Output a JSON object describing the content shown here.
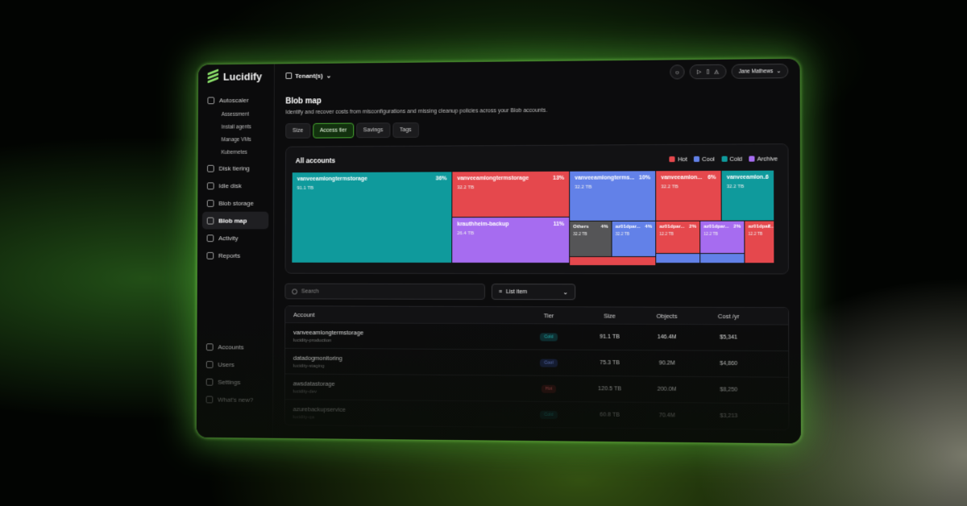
{
  "brand": {
    "name": "Lucidify",
    "accent": "#8be06a"
  },
  "sidebar": {
    "items": [
      {
        "label": "Autoscaler",
        "icon": "autoscaler-icon"
      },
      {
        "label": "Assessment",
        "sub": true
      },
      {
        "label": "Install agents",
        "sub": true
      },
      {
        "label": "Manage VMs",
        "sub": true
      },
      {
        "label": "Kubernetes",
        "sub": true
      },
      {
        "label": "Disk tiering",
        "icon": "disk-icon"
      },
      {
        "label": "Idle disk",
        "icon": "idle-disk-icon"
      },
      {
        "label": "Blob storage",
        "icon": "blob-icon"
      },
      {
        "label": "Blob map",
        "icon": "map-icon",
        "active": true
      },
      {
        "label": "Activity",
        "icon": "activity-icon"
      },
      {
        "label": "Reports",
        "icon": "reports-icon"
      }
    ],
    "bottom": [
      {
        "label": "Accounts",
        "icon": "key-icon"
      },
      {
        "label": "Users",
        "icon": "user-icon"
      },
      {
        "label": "Settings",
        "icon": "gear-icon"
      },
      {
        "label": "What's new?",
        "icon": "sparkle-icon"
      }
    ]
  },
  "topbar": {
    "tenant": "Tenant(s)",
    "user": "Jane Mathews"
  },
  "page": {
    "title": "Blob map",
    "subtitle": "Identify and recover costs from misconfigurations and missing cleanup policies across your Blob accounts."
  },
  "tabs": [
    "Size",
    "Access tier",
    "Savings",
    "Tags"
  ],
  "active_tab": "Access tier",
  "card": {
    "title": "All accounts",
    "legend": [
      {
        "label": "Hot",
        "color": "#e5484d"
      },
      {
        "label": "Cool",
        "color": "#6281e8"
      },
      {
        "label": "Cold",
        "color": "#0f9a9c"
      },
      {
        "label": "Archive",
        "color": "#a66cf0"
      }
    ],
    "tiles": [
      {
        "name": "vanveeamlongtermstorage",
        "pct": "36%",
        "size": "91.1 TB"
      },
      {
        "name": "vanveeamlongtermstorage",
        "pct": "13%",
        "size": "32.2 TB"
      },
      {
        "name": "krauthheim-backup",
        "pct": "11%",
        "size": "26.4 TB"
      },
      {
        "name": "vanveeamlongterms...",
        "pct": "10%",
        "size": "32.2 TB"
      },
      {
        "name": "Others",
        "pct": "4%",
        "size": "32.2 TB"
      },
      {
        "name": "az01dpar...",
        "pct": "4%",
        "size": "32.2 TB"
      },
      {
        "name": "vanveeamlon...",
        "pct": "6%",
        "size": "32.2 TB"
      },
      {
        "name": "vanveeamlon...",
        "pct": "6",
        "size": "32.2 TB"
      },
      {
        "name": "az01dpar...",
        "pct": "2%",
        "size": "12.2 TB"
      },
      {
        "name": "az01dpar...",
        "pct": "2%",
        "size": "12.2 TB"
      },
      {
        "name": "az01dpar...",
        "pct": "2",
        "size": "12.2 TB"
      }
    ]
  },
  "filters": {
    "search_placeholder": "Search",
    "view": "List item"
  },
  "table": {
    "headers": [
      "Account",
      "Tier",
      "Size",
      "Objects",
      "Cost /yr"
    ],
    "rows": [
      {
        "name": "vanveeamlongtermstorage",
        "sub": "lucidity-production",
        "tier": "Cold",
        "size": "91.1 TB",
        "objects": "146.4M",
        "cost": "$5,341"
      },
      {
        "name": "datadogmonitoring",
        "sub": "lucidity-staging",
        "tier": "Cool",
        "size": "75.3 TB",
        "objects": "90.2M",
        "cost": "$4,860"
      },
      {
        "name": "awsdatastorage",
        "sub": "lucidity-dev",
        "tier": "Hot",
        "size": "120.5 TB",
        "objects": "200.0M",
        "cost": "$8,250"
      },
      {
        "name": "azurebackupservice",
        "sub": "lucidity-qa",
        "tier": "Cold",
        "size": "60.8 TB",
        "objects": "70.4M",
        "cost": "$3,213"
      }
    ]
  }
}
